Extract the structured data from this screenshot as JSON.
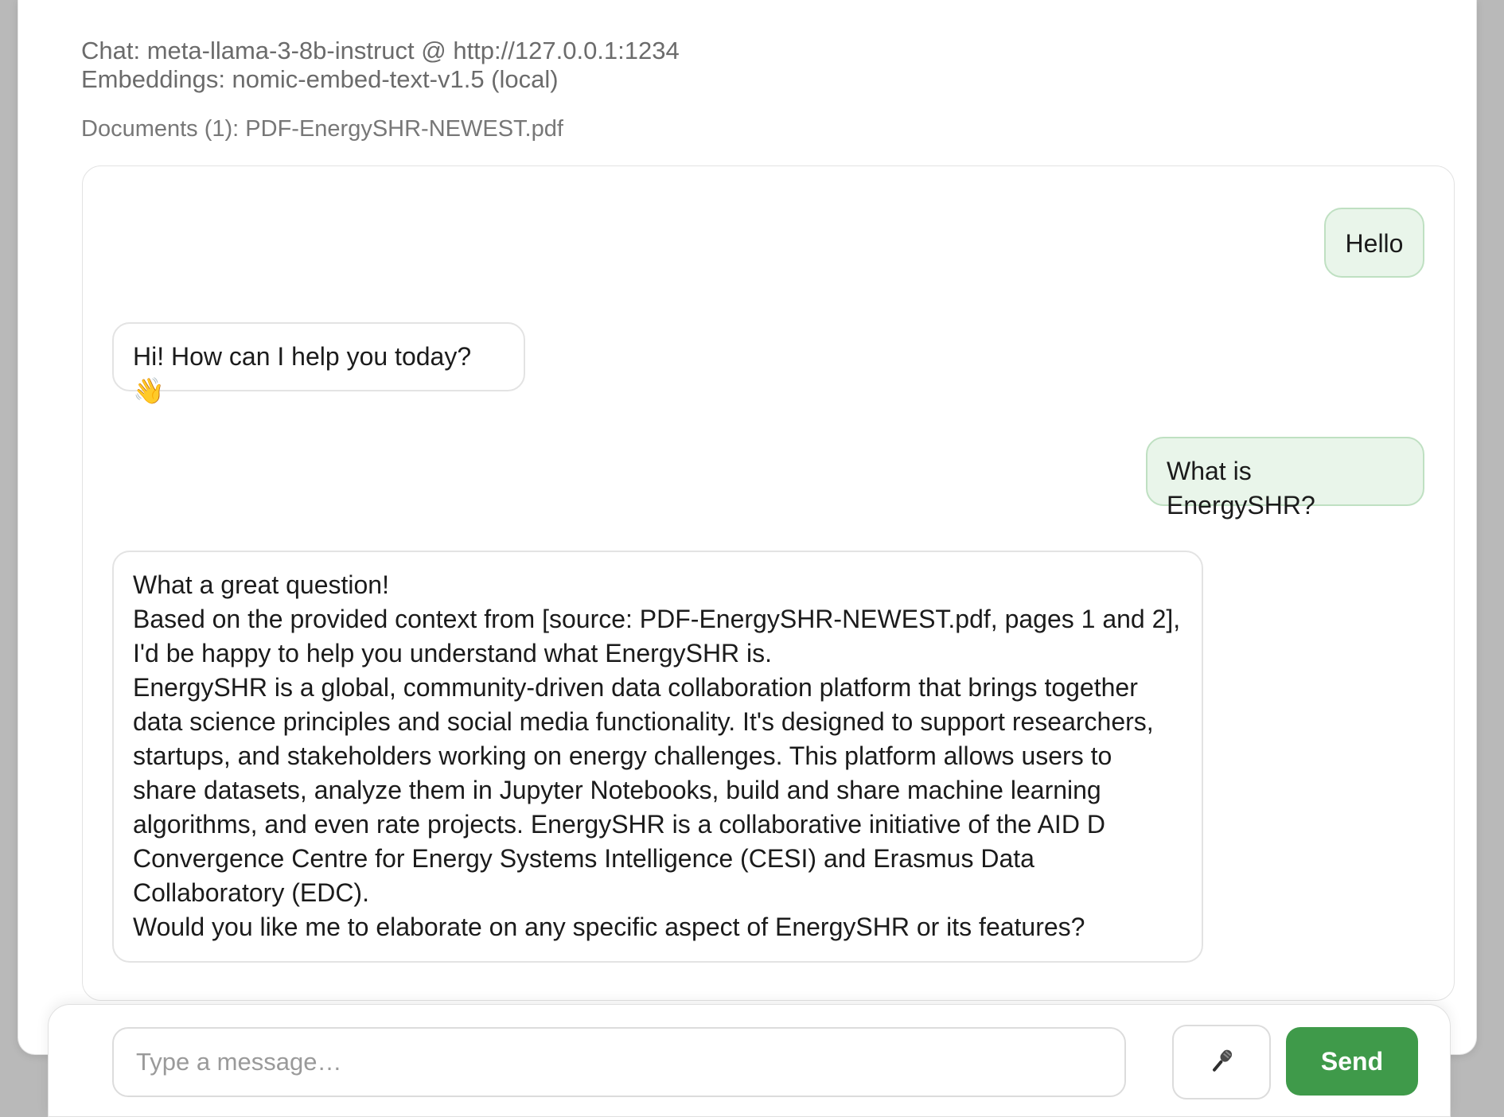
{
  "header": {
    "chat_model": "Chat: meta-llama-3-8b-instruct @ http://127.0.0.1:1234",
    "embeddings": "Embeddings: nomic-embed-text-v1.5 (local)",
    "documents": "Documents (1): PDF-EnergySHR-NEWEST.pdf"
  },
  "messages": [
    {
      "role": "user",
      "text": "Hello"
    },
    {
      "role": "assistant",
      "text": "Hi! How can I help you today? 👋"
    },
    {
      "role": "user",
      "text": "What is EnergySHR?"
    },
    {
      "role": "assistant",
      "lines": [
        "What a great question!",
        "Based on the provided context from [source: PDF-EnergySHR-NEWEST.pdf, pages 1 and 2], I'd be happy to help you understand what EnergySHR is.",
        "EnergySHR is a global, community-driven data collaboration platform that brings together data science principles and social media functionality. It's designed to support researchers, startups, and stakeholders working on energy challenges. This platform allows users to share datasets, analyze them in Jupyter Notebooks, build and share machine learning algorithms, and even rate projects. EnergySHR is a collaborative initiative of the AID D Convergence Centre for Energy Systems Intelligence (CESI) and Erasmus Data Collaboratory (EDC).",
        "Would you like me to elaborate on any specific aspect of EnergySHR or its features?"
      ]
    }
  ],
  "composer": {
    "placeholder": "Type a message…",
    "value": "",
    "mic_icon": "microphone-icon",
    "send_label": "Send"
  },
  "colors": {
    "user_bubble_bg": "#e9f5ea",
    "user_bubble_border": "#bfe0c2",
    "send_button": "#3f9a4a"
  }
}
